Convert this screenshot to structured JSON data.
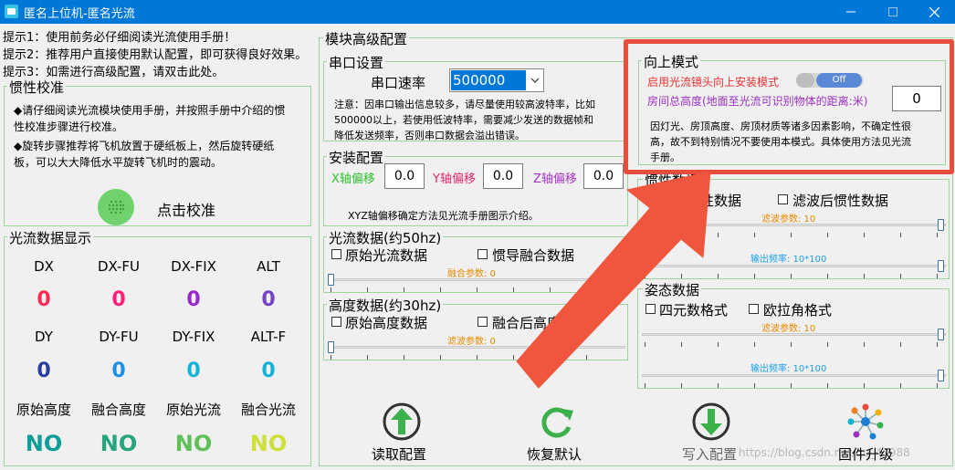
{
  "window": {
    "title": "匿名上位机-匿名光流"
  },
  "tips": [
    "提示1：使用前务必仔细阅读光流使用手册！",
    "提示2：推荐用户直接使用默认配置，即可获得良好效果。",
    "提示3：如需进行高级配置，请双击此处。"
  ],
  "inertial_calib": {
    "title": "惯性校准",
    "line1a": "◆请仔细阅读光流模块使用手册，并按照手册中介绍的惯",
    "line1b": "性校准步骤进行校准。",
    "line2a": "◆旋转步骤推荐将飞机放置于硬纸板上，然后旋转硬纸",
    "line2b": "板，可以大大降低水平旋转飞机时的震动。",
    "button_label": "点击校准"
  },
  "flow_display": {
    "title": "光流数据显示",
    "row1_labels": [
      "DX",
      "DX-FU",
      "DX-FIX",
      "ALT"
    ],
    "row1_values": [
      "0",
      "0",
      "0",
      "0"
    ],
    "row2_labels": [
      "DY",
      "DY-FU",
      "DY-FIX",
      "ALT-F"
    ],
    "row2_values": [
      "0",
      "0",
      "0",
      "0"
    ],
    "row3_labels": [
      "原始高度",
      "融合高度",
      "原始光流",
      "融合光流"
    ],
    "row3_values": [
      "NO",
      "NO",
      "NO",
      "NO"
    ],
    "colors": {
      "red": "#ff2a55",
      "pink": "#ff1f7a",
      "purple": "#9a28c8",
      "violet": "#7442c8",
      "navy": "#2b3d9a",
      "blue": "#1c8fe6",
      "cyan": "#13b3d6",
      "teal": "#0e9e98",
      "green1": "#27a37d",
      "green2": "#61bf59",
      "green3": "#9fd23f",
      "yellow": "#cde03a"
    }
  },
  "advanced": {
    "title": "模块高级配置",
    "serial": {
      "title": "串口设置",
      "baud_label": "串口速率",
      "baud_value": "500000",
      "note1": "注意：因串口输出信息较多，请尽量使用较高波特率，比如",
      "note2": "500000以上，若使用低波特率，需要减少发送的数据帧和",
      "note3": "降低发送频率，否则串口数据会溢出错误。"
    },
    "install": {
      "title": "安装配置",
      "x_label": "X轴偏移",
      "x_value": "0.0",
      "y_label": "Y轴偏移",
      "y_value": "0.0",
      "z_label": "Z轴偏移",
      "z_value": "0.0",
      "note": "XYZ轴偏移确定方法见光流手册图示介绍。",
      "x_color": "#2fc02f",
      "y_color": "#e0286e",
      "z_color": "#a832c8"
    },
    "flow50": {
      "title": "光流数据(约50hz)",
      "cb1": "原始光流数据",
      "cb2": "惯导融合数据",
      "param": "融合参数: 0"
    },
    "alt30": {
      "title": "高度数据(约30hz)",
      "cb1": "原始高度数据",
      "cb2": "融合后高度数据",
      "param": "滤波参数: 0"
    },
    "inertial": {
      "title": "惯性数据",
      "cb1": "原始惯性数据",
      "cb2": "滤波后惯性数据",
      "param": "滤波参数: 10",
      "freq": "输出频率: 10*100"
    },
    "attitude": {
      "title": "姿态数据",
      "cb1": "四元数格式",
      "cb2": "欧拉角格式",
      "param": "滤波参数: 10",
      "freq": "输出频率: 10*100"
    }
  },
  "upward": {
    "title": "向上模式",
    "enable_label": "启用光流镜头向上安装模式",
    "toggle_text": "Off",
    "height_label": "房间总高度(地面至光流可识别物体的距离:米)",
    "height_value": "0",
    "note1": "因灯光、房顶高度、房顶材质等诸多因素影响，不确定性很",
    "note2": "高，故不到特别情况不要使用本模式。具体使用方法见光流",
    "note3": "手册。",
    "enable_color": "#e53333",
    "height_color": "#9a2fbf"
  },
  "actions": {
    "read": "读取配置",
    "restore": "恢复默认",
    "write": "写入配置",
    "upgrade": "固件升级",
    "watermark": "https://blog.csdn.net/qq_41988"
  }
}
